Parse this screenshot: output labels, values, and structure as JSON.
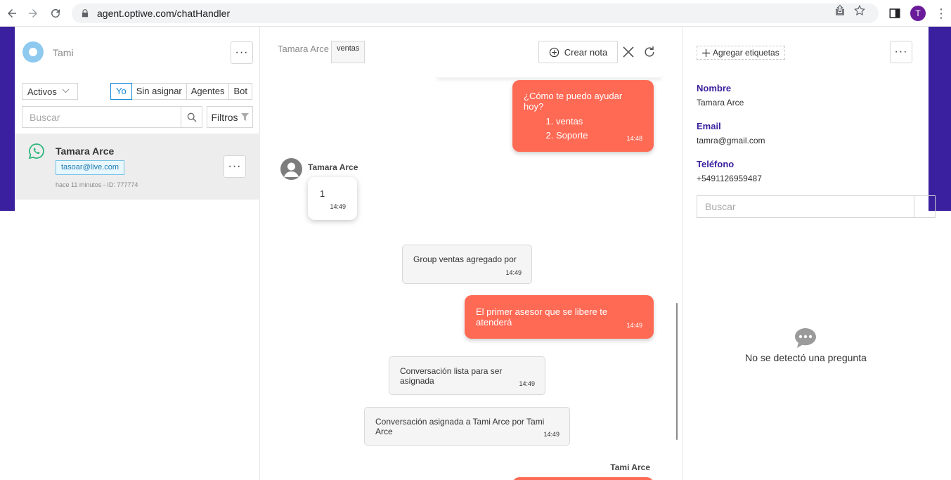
{
  "browser": {
    "url": "agent.optiwe.com/chatHandler",
    "profile_initial": "T"
  },
  "left": {
    "agent_name": "Tami",
    "status_filter": "Activos",
    "segments": [
      "Yo",
      "Sin asignar",
      "Agentes",
      "Bot"
    ],
    "search_placeholder": "Buscar",
    "filter_label": "Filtros",
    "conversation": {
      "name": "Tamara Arce",
      "tag": "tasoar@live.com",
      "meta": "hace 11 minutos - ID: 777774"
    }
  },
  "chat": {
    "contact_name": "Tamara Arce",
    "group_tag": "ventas",
    "note_button": "Crear nota",
    "messages": [
      {
        "type": "out",
        "text": "¿Cómo te puedo ayudar hoy?",
        "items": [
          "ventas",
          "Soporte"
        ],
        "time": "14:48"
      },
      {
        "type": "in",
        "sender": "Tamara Arce",
        "text": "1",
        "time": "14:49"
      },
      {
        "type": "system",
        "text": "Group ventas agregado por",
        "time": "14:49"
      },
      {
        "type": "out",
        "text": "El primer asesor que se libere te atenderá",
        "time": "14:49"
      },
      {
        "type": "system",
        "text": "Conversación lista para ser asignada",
        "time": "14:49"
      },
      {
        "type": "system",
        "text": "Conversación asignada a Tami Arce por Tami Arce",
        "time": "14:49"
      }
    ],
    "agent_label": "Tami Arce"
  },
  "right": {
    "add_tags": "Agregar etiquetas",
    "fields": [
      {
        "label": "Nombre",
        "value": "Tamara Arce"
      },
      {
        "label": "Email",
        "value": "tamra@gmail.com"
      },
      {
        "label": "Teléfono",
        "value": "+5491126959487"
      }
    ],
    "search_placeholder": "Buscar",
    "no_question": "No se detectó una pregunta"
  },
  "colors": {
    "brand_purple": "#3a1f9e",
    "outgoing_bubble": "#ff6a55",
    "accent_blue": "#1a8cd8"
  }
}
